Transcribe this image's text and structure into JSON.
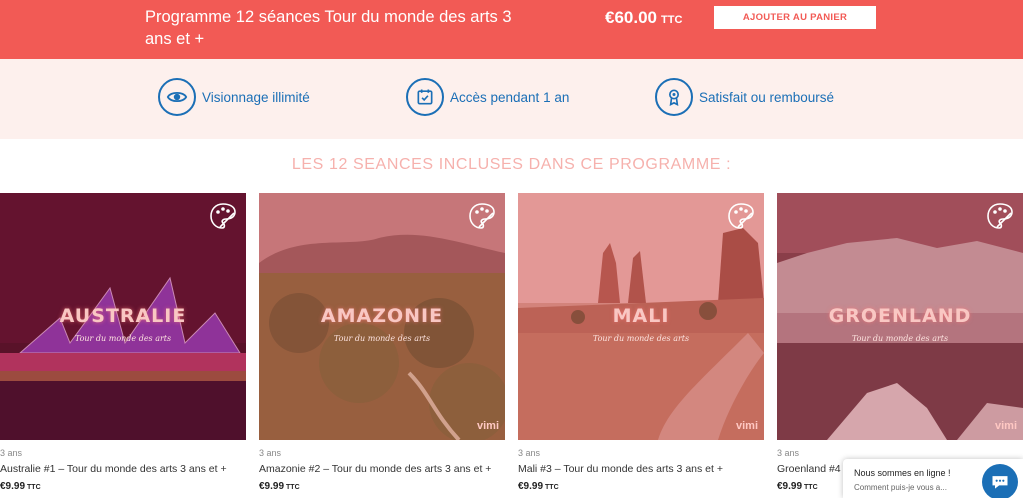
{
  "banner": {
    "title": "Programme 12 séances Tour du monde des arts 3 ans et +",
    "price": "€60.00",
    "price_suffix": "TTC",
    "cart_button": "AJOUTER AU PANIER",
    "background_color": "#f25a55"
  },
  "benefits": [
    {
      "icon": "eye-icon",
      "label": "Visionnage illimité"
    },
    {
      "icon": "calendar-check-icon",
      "label": "Accès pendant 1 an"
    },
    {
      "icon": "award-icon",
      "label": "Satisfait ou remboursé"
    }
  ],
  "section_title": "LES 12 SEANCES INCLUSES DANS CE PROGRAMME :",
  "cards": [
    {
      "place": "AUSTRALIE",
      "subtitle": "Tour du monde des arts",
      "watermark": "",
      "age": "3 ans",
      "name": "Australie #1 – Tour du monde des arts 3 ans et +",
      "price": "€9.99",
      "price_suffix": "TTC"
    },
    {
      "place": "AMAZONIE",
      "subtitle": "Tour du monde des arts",
      "watermark": "vimi",
      "age": "3 ans",
      "name": "Amazonie #2 – Tour du monde des arts 3 ans et +",
      "price": "€9.99",
      "price_suffix": "TTC"
    },
    {
      "place": "MALI",
      "subtitle": "Tour du monde des arts",
      "watermark": "vimi",
      "age": "3 ans",
      "name": "Mali #3 – Tour du monde des arts 3 ans et +",
      "price": "€9.99",
      "price_suffix": "TTC"
    },
    {
      "place": "GROENLAND",
      "subtitle": "Tour du monde des arts",
      "watermark": "vimi",
      "age": "3 ans",
      "name": "Groenland #4",
      "price": "€9.99",
      "price_suffix": "TTC"
    }
  ],
  "chat": {
    "title": "Nous sommes en ligne !",
    "subtitle": "Comment puis-je vous a..."
  },
  "colors": {
    "accent": "#f25a55",
    "icon_blue": "#1b6fb6",
    "benefits_bg": "#fdf0ed"
  }
}
